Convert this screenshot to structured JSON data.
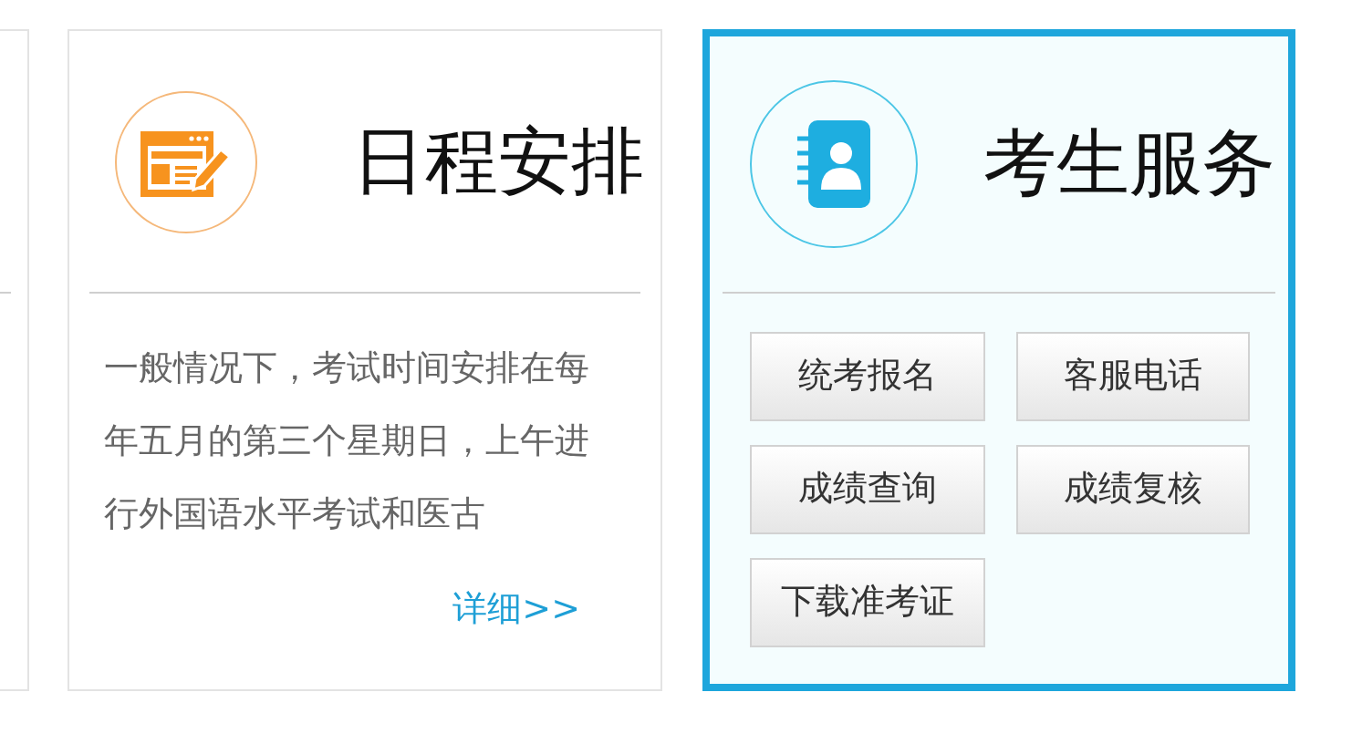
{
  "cards": [
    {
      "kind": "info",
      "selected": false,
      "title": "日程安排",
      "text": "一般情况下，考试时间安排在每年五月的第三个星期日，上午进行外国语水平考试和医古",
      "link": "详细>>"
    },
    {
      "kind": "services",
      "selected": true,
      "title": "考生服务",
      "buttons": [
        "统考报名",
        "客服电话",
        "成绩查询",
        "成绩复核",
        "下载准考证"
      ]
    }
  ]
}
